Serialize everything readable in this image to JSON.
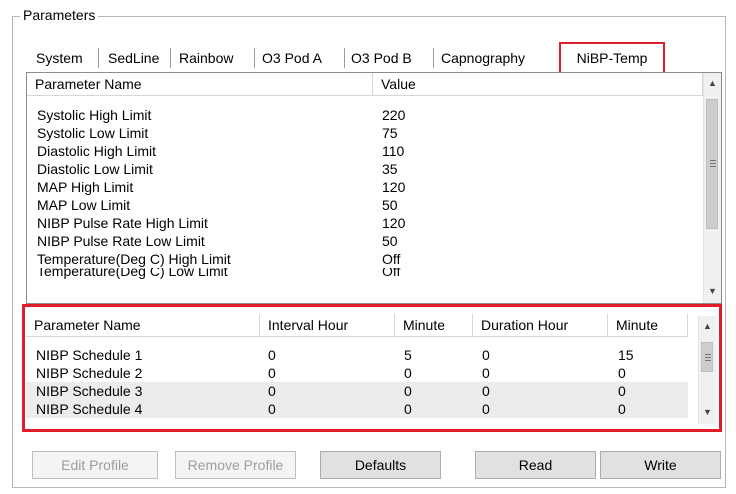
{
  "group_title": "Parameters",
  "tabs": [
    {
      "label": "System"
    },
    {
      "label": "SedLine"
    },
    {
      "label": "Rainbow"
    },
    {
      "label": "O3 Pod A"
    },
    {
      "label": "O3 Pod B"
    },
    {
      "label": "Capnography"
    },
    {
      "label": "NiBP-Temp",
      "active": true
    }
  ],
  "params_table": {
    "headers": [
      "Parameter Name",
      "Value"
    ],
    "rows": [
      [
        "Systolic High Limit",
        "220"
      ],
      [
        "Systolic Low Limit",
        "75"
      ],
      [
        "Diastolic High Limit",
        "110"
      ],
      [
        "Diastolic Low Limit",
        "35"
      ],
      [
        "MAP High Limit",
        "120"
      ],
      [
        "MAP Low Limit",
        "50"
      ],
      [
        "NIBP Pulse Rate High Limit",
        "120"
      ],
      [
        "NIBP Pulse Rate Low Limit",
        "50"
      ],
      [
        "Temperature(Deg C) High Limit",
        "Off"
      ],
      [
        "Temperature(Deg C) Low Limit",
        "Off"
      ]
    ]
  },
  "schedule_table": {
    "headers": [
      "Parameter Name",
      "Interval Hour",
      "Minute",
      "Duration Hour",
      "Minute"
    ],
    "rows": [
      [
        "NIBP Schedule 1",
        "0",
        "5",
        "0",
        "15"
      ],
      [
        "NIBP Schedule 2",
        "0",
        "0",
        "0",
        "0"
      ],
      [
        "NIBP Schedule 3",
        "0",
        "0",
        "0",
        "0"
      ],
      [
        "NIBP Schedule 4",
        "0",
        "0",
        "0",
        "0"
      ]
    ]
  },
  "buttons": {
    "edit_profile": "Edit Profile",
    "remove_profile": "Remove Profile",
    "defaults": "Defaults",
    "read": "Read",
    "write": "Write"
  },
  "colors": {
    "highlight": "#e01e2b"
  }
}
